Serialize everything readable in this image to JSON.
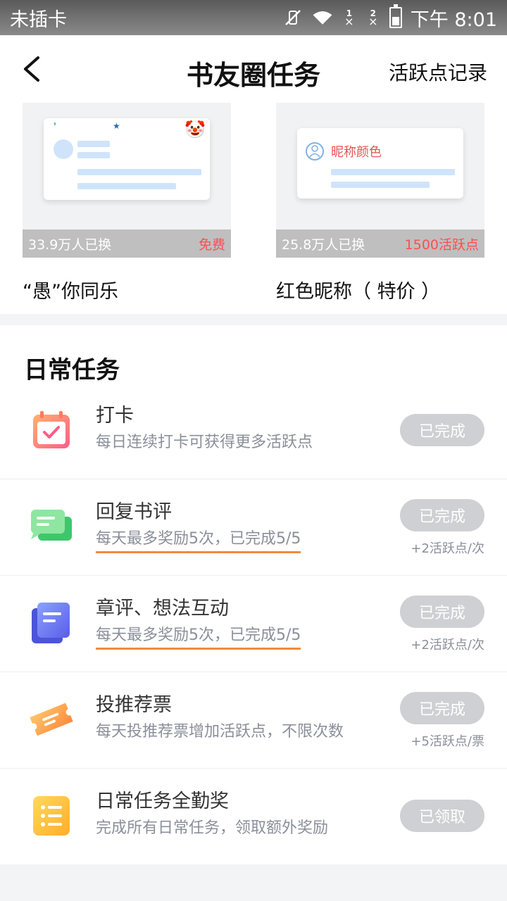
{
  "status_bar": {
    "carrier": "未插卡",
    "time": "下午 8:01",
    "sim1": "1",
    "sim2": "2"
  },
  "header": {
    "title": "书友圈任务",
    "action": "活跃点记录"
  },
  "rewards": [
    {
      "count": "33.9万人已换",
      "price": "免费",
      "name": "“愚”你同乐"
    },
    {
      "count": "25.8万人已换",
      "price": "1500活跃点",
      "name": "红色昵称（ 特价 ）",
      "preview_text": "昵称颜色"
    }
  ],
  "daily": {
    "title": "日常任务",
    "tasks": [
      {
        "name": "打卡",
        "desc": "每日连续打卡可获得更多活跃点",
        "button": "已完成",
        "reward": ""
      },
      {
        "name": "回复书评",
        "desc": "每天最多奖励5次，已完成5/5",
        "button": "已完成",
        "reward": "+2活跃点/次"
      },
      {
        "name": "章评、想法互动",
        "desc": "每天最多奖励5次，已完成5/5",
        "button": "已完成",
        "reward": "+2活跃点/次"
      },
      {
        "name": "投推荐票",
        "desc": "每天投推荐票增加活跃点，不限次数",
        "button": "已完成",
        "reward": "+5活跃点/票"
      },
      {
        "name": "日常任务全勤奖",
        "desc": "完成所有日常任务，领取额外奖励",
        "button": "已领取",
        "reward": ""
      }
    ]
  },
  "colors": {
    "accent_red": "#ff4d4f",
    "button_disabled": "#cfd0d3",
    "progress_underline": "#f08a3e"
  }
}
